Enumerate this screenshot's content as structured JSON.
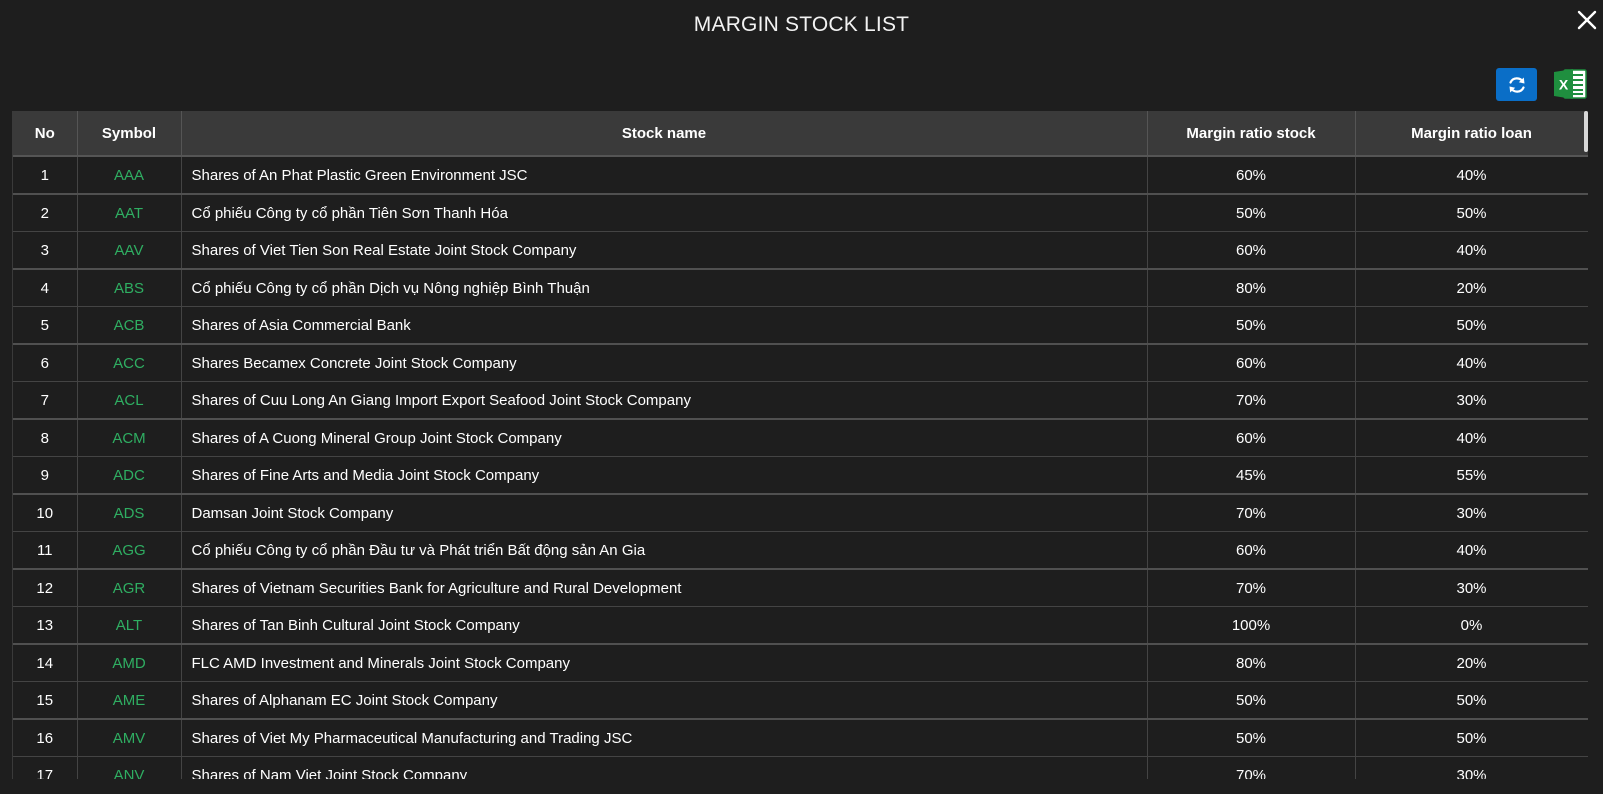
{
  "title": "MARGIN STOCK LIST",
  "icons": {
    "close": "close-icon",
    "refresh": "refresh-icon",
    "excel": "excel-icon"
  },
  "colors": {
    "background": "#1e1e1e",
    "header_bg": "#3a3a3a",
    "symbol": "#2fae62",
    "refresh_button": "#0a6ec7",
    "excel_green": "#1f8f3f"
  },
  "table": {
    "headers": {
      "no": "No",
      "symbol": "Symbol",
      "name": "Stock name",
      "margin_stock": "Margin ratio stock",
      "margin_loan": "Margin ratio loan"
    },
    "rows": [
      {
        "no": "1",
        "symbol": "AAA",
        "name": "Shares of An Phat Plastic Green Environment JSC",
        "margin_stock": "60%",
        "margin_loan": "40%"
      },
      {
        "no": "2",
        "symbol": "AAT",
        "name": "Cổ phiếu Công ty cổ phần Tiên Sơn Thanh Hóa",
        "margin_stock": "50%",
        "margin_loan": "50%"
      },
      {
        "no": "3",
        "symbol": "AAV",
        "name": "Shares of Viet Tien Son Real Estate Joint Stock Company",
        "margin_stock": "60%",
        "margin_loan": "40%"
      },
      {
        "no": "4",
        "symbol": "ABS",
        "name": "Cổ phiếu Công ty cổ phần Dịch vụ Nông nghiệp Bình Thuận",
        "margin_stock": "80%",
        "margin_loan": "20%"
      },
      {
        "no": "5",
        "symbol": "ACB",
        "name": "Shares of Asia Commercial Bank",
        "margin_stock": "50%",
        "margin_loan": "50%"
      },
      {
        "no": "6",
        "symbol": "ACC",
        "name": "Shares Becamex Concrete Joint Stock Company",
        "margin_stock": "60%",
        "margin_loan": "40%"
      },
      {
        "no": "7",
        "symbol": "ACL",
        "name": "Shares of Cuu Long An Giang Import Export Seafood Joint Stock Company",
        "margin_stock": "70%",
        "margin_loan": "30%"
      },
      {
        "no": "8",
        "symbol": "ACM",
        "name": "Shares of A Cuong Mineral Group Joint Stock Company",
        "margin_stock": "60%",
        "margin_loan": "40%"
      },
      {
        "no": "9",
        "symbol": "ADC",
        "name": "Shares of Fine Arts and Media Joint Stock Company",
        "margin_stock": "45%",
        "margin_loan": "55%"
      },
      {
        "no": "10",
        "symbol": "ADS",
        "name": "Damsan Joint Stock Company",
        "margin_stock": "70%",
        "margin_loan": "30%"
      },
      {
        "no": "11",
        "symbol": "AGG",
        "name": "Cổ phiếu Công ty cổ phần Đầu tư và Phát triển Bất động sản An Gia",
        "margin_stock": "60%",
        "margin_loan": "40%"
      },
      {
        "no": "12",
        "symbol": "AGR",
        "name": "Shares of Vietnam Securities Bank for Agriculture and Rural Development",
        "margin_stock": "70%",
        "margin_loan": "30%"
      },
      {
        "no": "13",
        "symbol": "ALT",
        "name": "Shares of Tan Binh Cultural Joint Stock Company",
        "margin_stock": "100%",
        "margin_loan": "0%"
      },
      {
        "no": "14",
        "symbol": "AMD",
        "name": "FLC AMD Investment and Minerals Joint Stock Company",
        "margin_stock": "80%",
        "margin_loan": "20%"
      },
      {
        "no": "15",
        "symbol": "AME",
        "name": "Shares of Alphanam EC Joint Stock Company",
        "margin_stock": "50%",
        "margin_loan": "50%"
      },
      {
        "no": "16",
        "symbol": "AMV",
        "name": "Shares of Viet My Pharmaceutical Manufacturing and Trading JSC",
        "margin_stock": "50%",
        "margin_loan": "50%"
      },
      {
        "no": "17",
        "symbol": "ANV",
        "name": "Shares of Nam Viet Joint Stock Company",
        "margin_stock": "70%",
        "margin_loan": "30%"
      }
    ]
  }
}
